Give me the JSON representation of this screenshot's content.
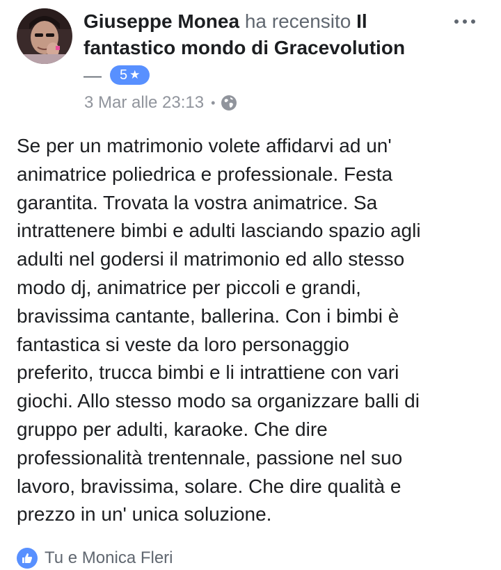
{
  "header": {
    "author_name": "Giuseppe Monea",
    "verb": "ha recensito",
    "page_name": "Il fantastico mondo di Gracevolution",
    "dash": "—"
  },
  "rating": {
    "value": "5",
    "star": "★",
    "color": "#5890ff"
  },
  "meta": {
    "timestamp": "3 Mar alle 23:13",
    "separator": "•",
    "privacy_icon": "globe-icon"
  },
  "more_icon": "more-options-icon",
  "review": {
    "text": "Se per un matrimonio volete affidarvi ad un'\nanimatrice poliedrica e professionale. Festa\ngarantita. Trovata la vostra animatrice. Sa\nintrattenere bimbi e adulti lasciando spazio agli\nadulti nel godersi il matrimonio ed allo stesso\nmodo dj, animatrice per piccoli e grandi,\nbravissima cantante, ballerina. Con i bimbi è\nfantastica si veste da loro personaggio\npreferito, trucca bimbi e li intrattiene con vari\ngiochi. Allo stesso modo sa organizzare balli di\ngruppo per adulti, karaoke. Che dire\nprofessionalità trentennale, passione nel suo\nlavoro, bravissima, solare. Che dire qualità e\nprezzo in un' unica soluzione."
  },
  "footer": {
    "reactions_text": "Tu e Monica Fleri",
    "reaction_icon": "like-icon"
  }
}
